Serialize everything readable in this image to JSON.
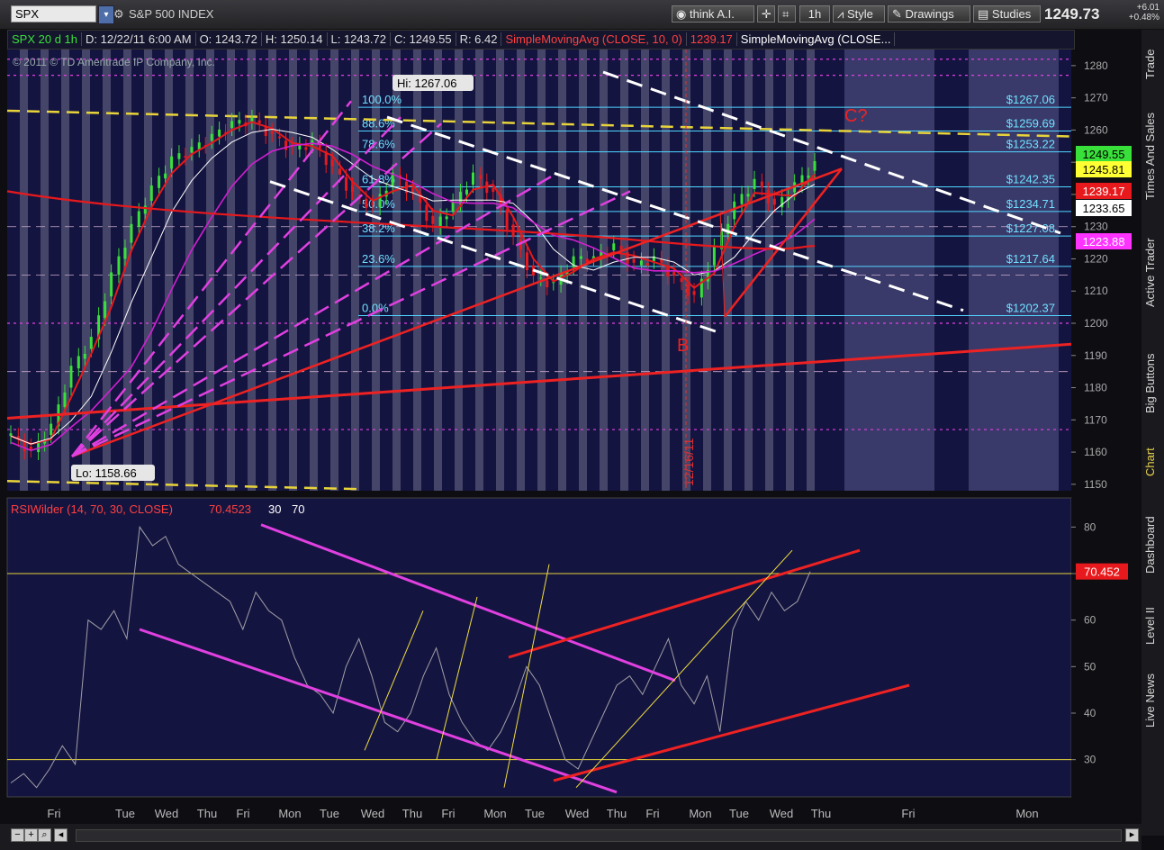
{
  "toolbar": {
    "symbol": "SPX",
    "symbol_name": "S&P 500 INDEX",
    "buttons": [
      {
        "label": "think A.I.",
        "icon": "think-ai-icon"
      },
      {
        "label": "",
        "icon": "cursor-icon"
      },
      {
        "label": "",
        "icon": "compare-icon"
      },
      {
        "label": "1h",
        "icon": ""
      },
      {
        "label": "Style",
        "icon": "style-icon"
      },
      {
        "label": "Drawings",
        "icon": "drawings-icon"
      },
      {
        "label": "Studies",
        "icon": "studies-icon"
      }
    ],
    "last_price": "1249.73",
    "change": "+6.01",
    "change_pct": "+0.48%"
  },
  "infobar": {
    "title": "SPX 20 d 1h",
    "date": "D: 12/22/11 6:00 AM",
    "open": "O: 1243.72",
    "high": "H: 1250.14",
    "low": "L: 1243.72",
    "close": "C: 1249.55",
    "range": "R: 6.42",
    "sma1": "SimpleMovingAvg (CLOSE, 10, 0)",
    "sma1_val": "1239.17",
    "sma2": "SimpleMovingAvg (CLOSE..."
  },
  "copyright": "© 2011 © TD Ameritrade IP Company, Inc.",
  "sidebar_tabs": [
    {
      "label": "Trade",
      "active": false
    },
    {
      "label": "Times And Sales",
      "active": false
    },
    {
      "label": "Active Trader",
      "active": false
    },
    {
      "label": "Big Buttons",
      "active": false
    },
    {
      "label": "Chart",
      "active": true
    },
    {
      "label": "Dashboard",
      "active": false
    },
    {
      "label": "Level II",
      "active": false
    },
    {
      "label": "Live News",
      "active": false
    }
  ],
  "chart_data": [
    {
      "type": "candlestick",
      "title": "SPX 20 d 1h",
      "ylim": [
        1148,
        1285
      ],
      "y_ticks": [
        1150,
        1160,
        1170,
        1180,
        1190,
        1200,
        1210,
        1220,
        1230,
        1240,
        1250,
        1260,
        1270,
        1280
      ],
      "x_tick_labels": [
        "Fri",
        "Tue",
        "Wed",
        "Thu",
        "Fri",
        "Mon",
        "Tue",
        "Wed",
        "Thu",
        "Fri",
        "Mon",
        "Tue",
        "Wed",
        "Thu",
        "Fri",
        "Mon",
        "Tue",
        "Wed",
        "Thu",
        "Fri",
        "Mon"
      ],
      "vertical_date_label": "12/16/11",
      "close_path": [
        1165,
        1160,
        1168,
        1186,
        1195,
        1215,
        1230,
        1242,
        1251,
        1254,
        1258,
        1262,
        1263,
        1258,
        1254,
        1256,
        1248,
        1240,
        1236,
        1246,
        1240,
        1230,
        1237,
        1246,
        1240,
        1226,
        1214,
        1212,
        1220,
        1220,
        1224,
        1218,
        1220,
        1214,
        1208,
        1223,
        1237,
        1244,
        1236,
        1243,
        1249.55
      ],
      "fibonacci": [
        {
          "level": "100.0%",
          "price": 1267.06,
          "label": "$1267.06"
        },
        {
          "level": "88.6%",
          "price": 1259.69,
          "label": "$1259.69"
        },
        {
          "level": "78.6%",
          "price": 1253.22,
          "label": "$1253.22"
        },
        {
          "level": "61.8%",
          "price": 1242.35,
          "label": "$1242.35"
        },
        {
          "level": "50.0%",
          "price": 1234.71,
          "label": "$1234.71"
        },
        {
          "level": "38.2%",
          "price": 1227.08,
          "label": "$1227.08"
        },
        {
          "level": "23.6%",
          "price": 1217.64,
          "label": "$1217.64"
        },
        {
          "level": "0.0%",
          "price": 1202.37,
          "label": "$1202.37"
        }
      ],
      "high_label": "Hi: 1267.06",
      "low_label": "Lo: 1158.66",
      "annotations": [
        "B",
        "C?"
      ],
      "price_badges": [
        {
          "value": "1249.55",
          "color": "#39e03a"
        },
        {
          "value": "1245.81",
          "color": "#ffff33"
        },
        {
          "value": "1239.17",
          "color": "#e8191c"
        },
        {
          "value": "1233.65",
          "color": "#ffffff"
        },
        {
          "value": "1223.88",
          "color": "#ff33ff"
        }
      ]
    },
    {
      "type": "line",
      "title": "RSIWilder (14, 70, 30, CLOSE)",
      "value_label": "70.4523",
      "levels": [
        "30",
        "70"
      ],
      "ylim": [
        22,
        82
      ],
      "y_ticks": [
        30,
        40,
        50,
        60,
        70,
        80
      ],
      "badge": "70.452",
      "values": [
        25,
        27,
        24,
        28,
        33,
        29,
        60,
        58,
        62,
        56,
        80,
        76,
        78,
        72,
        70,
        68,
        66,
        64,
        58,
        66,
        62,
        60,
        52,
        46,
        44,
        40,
        50,
        56,
        48,
        38,
        36,
        40,
        48,
        54,
        44,
        38,
        34,
        32,
        36,
        42,
        50,
        46,
        38,
        30,
        28,
        34,
        40,
        46,
        48,
        44,
        50,
        56,
        46,
        42,
        48,
        36,
        58,
        64,
        60,
        66,
        62,
        64,
        70.45
      ]
    }
  ]
}
